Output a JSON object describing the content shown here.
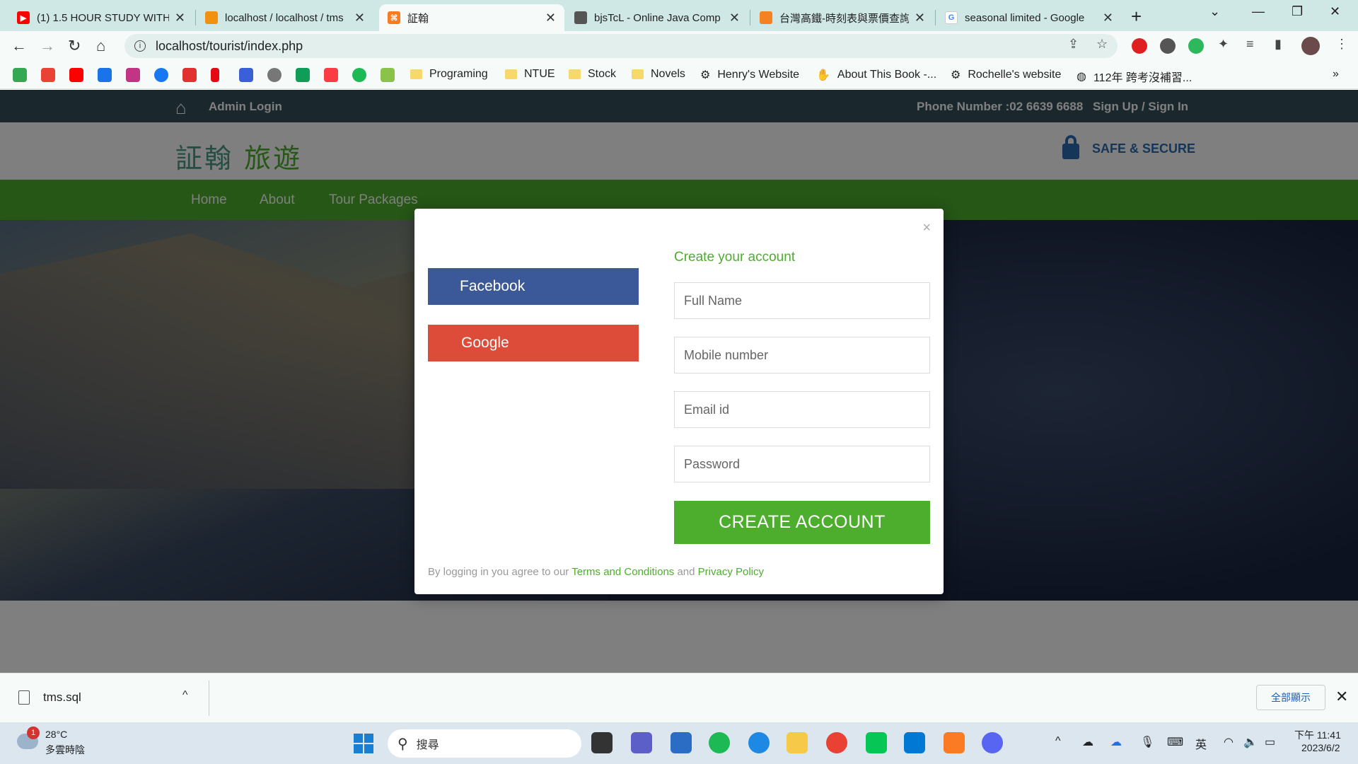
{
  "browser": {
    "tabs": [
      {
        "title": "(1) 1.5 HOUR STUDY WITH",
        "favicon": "youtube-icon",
        "color": "#ff0000"
      },
      {
        "title": "localhost / localhost / tms",
        "favicon": "phpmyadmin-icon",
        "color": "#f29111"
      },
      {
        "title": "証翰",
        "favicon": "xampp-icon",
        "color": "#fb7a24"
      },
      {
        "title": "bjsTcL - Online Java Comp",
        "favicon": "jdoodle-icon",
        "color": "#555555"
      },
      {
        "title": "台灣高鐵-時刻表與票價查詢",
        "favicon": "thsr-icon",
        "color": "#f58220"
      },
      {
        "title": "seasonal limited - Google",
        "favicon": "google-icon",
        "color": "#4285f4"
      }
    ],
    "url": "localhost/tourist/index.php",
    "bookmarks": [
      {
        "label": "Programing",
        "type": "folder"
      },
      {
        "label": "NTUE",
        "type": "folder"
      },
      {
        "label": "Stock",
        "type": "folder"
      },
      {
        "label": "Novels",
        "type": "folder"
      },
      {
        "label": "Henry's Website",
        "type": "link"
      },
      {
        "label": "About This Book -...",
        "type": "link"
      },
      {
        "label": "Rochelle's website",
        "type": "link"
      },
      {
        "label": "112年 跨考沒補習...",
        "type": "link"
      }
    ]
  },
  "site": {
    "admin_login": "Admin Login",
    "phone": "Phone Number :02 6639 6688",
    "signup": "Sign Up / Sign In",
    "logo_part1": "証翰",
    "logo_part2": "旅遊",
    "secure": "SAFE & SECURE",
    "nav": [
      "Home",
      "About",
      "Tour Packages"
    ]
  },
  "modal": {
    "close": "×",
    "facebook": "Facebook",
    "google": "Google",
    "title": "Create your account",
    "fields": {
      "full_name": "Full Name",
      "mobile": "Mobile number",
      "email": "Email id",
      "password": "Password"
    },
    "submit": "CREATE ACCOUNT",
    "terms_prefix": "By logging in you agree to our",
    "terms_link": "Terms and Conditions",
    "terms_and": "and",
    "privacy_link": "Privacy Policy"
  },
  "download_bar": {
    "file": "tms.sql",
    "show_all": "全部顯示"
  },
  "taskbar": {
    "badge": "1",
    "temperature": "28°C",
    "condition": "多雲時陰",
    "search_placeholder": "搜尋",
    "ime": "英",
    "time": "下午 11:41",
    "date": "2023/6/2"
  },
  "colors": {
    "accent_green": "#4cae2c",
    "topbar": "#34515c",
    "facebook": "#3b5998",
    "google": "#dd4b39"
  }
}
